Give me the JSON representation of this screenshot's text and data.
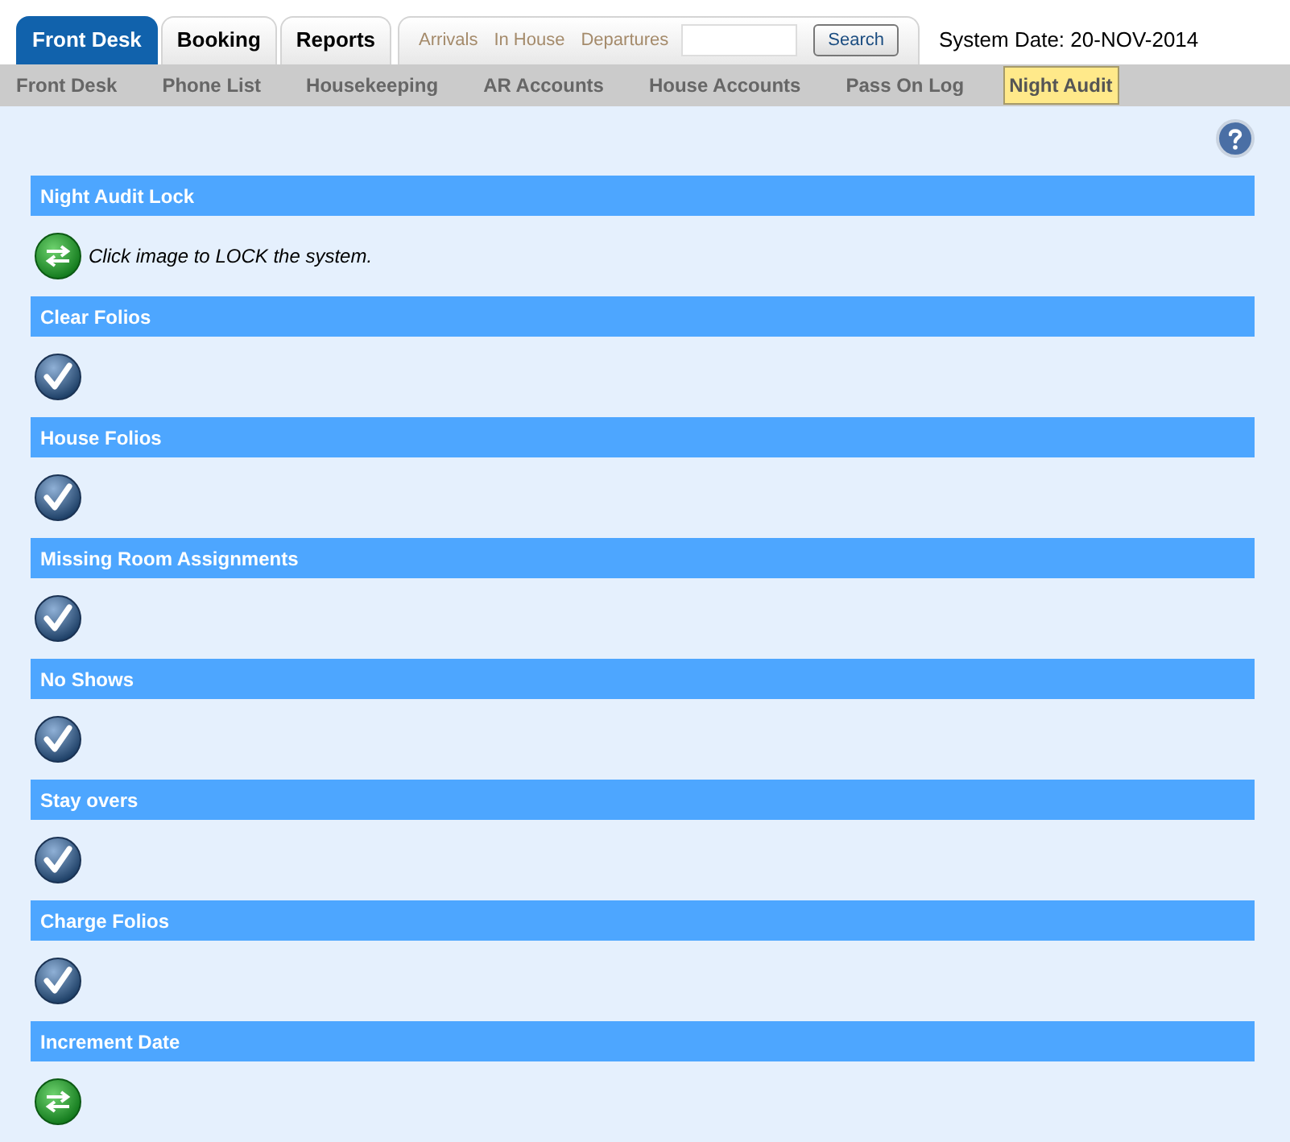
{
  "tabs": [
    {
      "label": "Front Desk",
      "selected": true
    },
    {
      "label": "Booking",
      "selected": false
    },
    {
      "label": "Reports",
      "selected": false
    }
  ],
  "quick_links": [
    "Arrivals",
    "In House",
    "Departures"
  ],
  "search": {
    "button": "Search"
  },
  "system_date": "System Date: 20-NOV-2014",
  "subnav": [
    {
      "label": "Front Desk",
      "selected": false
    },
    {
      "label": "Phone List",
      "selected": false
    },
    {
      "label": "Housekeeping",
      "selected": false
    },
    {
      "label": "AR Accounts",
      "selected": false
    },
    {
      "label": "House Accounts",
      "selected": false
    },
    {
      "label": "Pass On Log",
      "selected": false
    },
    {
      "label": "Night Audit",
      "selected": true
    }
  ],
  "sections": [
    {
      "title": "Night Audit Lock",
      "kind": "action",
      "text": "Click image to LOCK the system."
    },
    {
      "title": "Clear Folios",
      "kind": "done"
    },
    {
      "title": "House Folios",
      "kind": "done"
    },
    {
      "title": "Missing Room Assignments",
      "kind": "done"
    },
    {
      "title": "No Shows",
      "kind": "done"
    },
    {
      "title": "Stay overs",
      "kind": "done"
    },
    {
      "title": "Charge Folios",
      "kind": "done"
    },
    {
      "title": "Increment Date",
      "kind": "action"
    }
  ]
}
